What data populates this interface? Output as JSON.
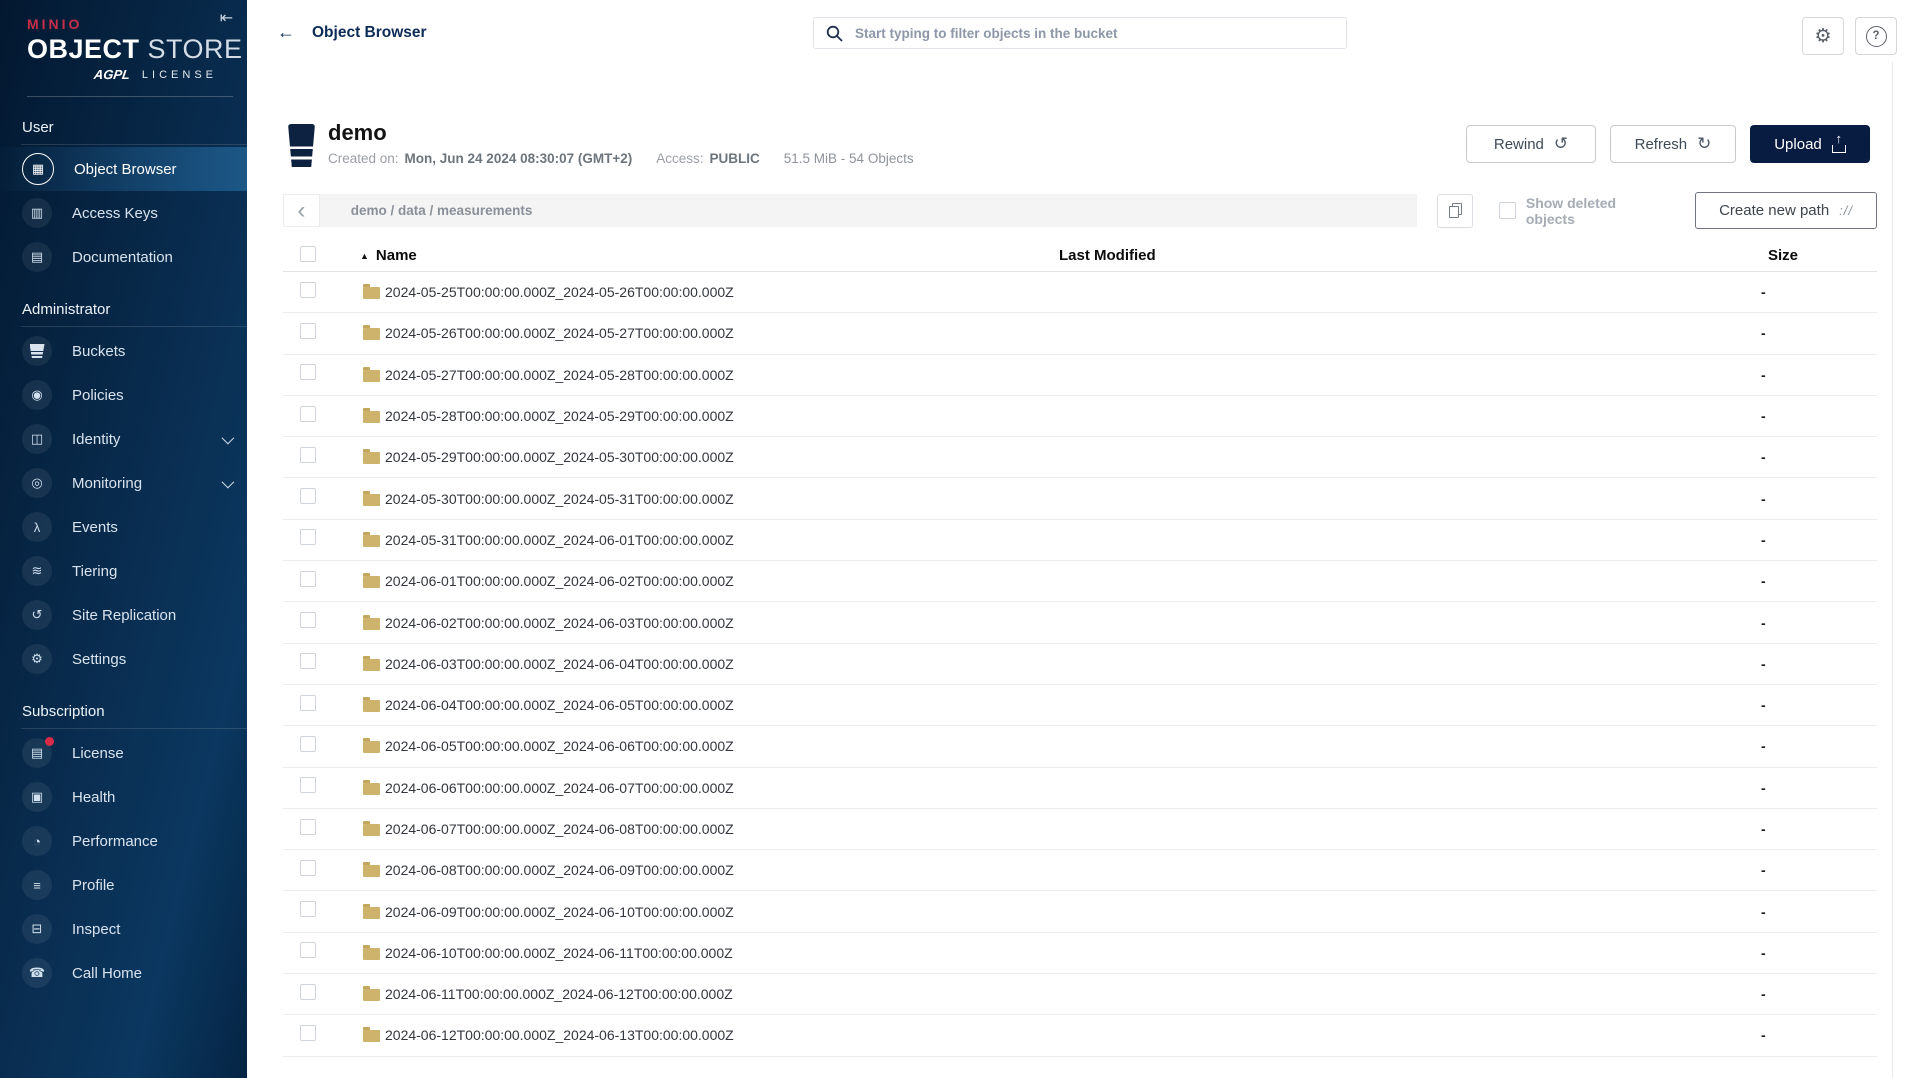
{
  "colors": {
    "accent_navy": "#081C42",
    "minio_red": "#C72E49",
    "sidebar_highlight": "#1C5786",
    "folder_gold": "#CDB36C"
  },
  "sidebar": {
    "collapse_glyph": "⇤",
    "logo": {
      "brand": "MINIO",
      "product_bold": "OBJECT",
      "product_light": "STORE",
      "license_badge": "AGPL",
      "license_word": "LICENSE"
    },
    "sections": [
      {
        "label": "User",
        "items": [
          {
            "id": "object-browser",
            "label": "Object Browser",
            "icon": "object-browser-icon",
            "glyph": "▦",
            "active": true
          },
          {
            "id": "access-keys",
            "label": "Access Keys",
            "icon": "access-keys-icon",
            "glyph": "▥"
          },
          {
            "id": "documentation",
            "label": "Documentation",
            "icon": "documentation-icon",
            "glyph": "▤"
          }
        ]
      },
      {
        "label": "Administrator",
        "items": [
          {
            "id": "buckets",
            "label": "Buckets",
            "icon": "bucket-icon",
            "glyph": ""
          },
          {
            "id": "policies",
            "label": "Policies",
            "icon": "policies-icon",
            "glyph": "◉"
          },
          {
            "id": "identity",
            "label": "Identity",
            "icon": "identity-icon",
            "glyph": "◫",
            "chevron": true
          },
          {
            "id": "monitoring",
            "label": "Monitoring",
            "icon": "monitoring-icon",
            "glyph": "◎",
            "chevron": true
          },
          {
            "id": "events",
            "label": "Events",
            "icon": "events-lambda-icon",
            "glyph": "λ"
          },
          {
            "id": "tiering",
            "label": "Tiering",
            "icon": "tiering-layers-icon",
            "glyph": "≋"
          },
          {
            "id": "site-replication",
            "label": "Site Replication",
            "icon": "site-replication-icon",
            "glyph": "↺"
          },
          {
            "id": "settings",
            "label": "Settings",
            "icon": "settings-gear-icon",
            "glyph": "⚙"
          }
        ]
      },
      {
        "label": "Subscription",
        "items": [
          {
            "id": "license",
            "label": "License",
            "icon": "license-icon",
            "glyph": "▤",
            "badge": true
          },
          {
            "id": "health",
            "label": "Health",
            "icon": "health-icon",
            "glyph": "▣"
          },
          {
            "id": "performance",
            "label": "Performance",
            "icon": "performance-gauge-icon",
            "glyph": "◔"
          },
          {
            "id": "profile",
            "label": "Profile",
            "icon": "profile-icon",
            "glyph": "≡"
          },
          {
            "id": "inspect",
            "label": "Inspect",
            "icon": "inspect-icon",
            "glyph": "⊟"
          },
          {
            "id": "call-home",
            "label": "Call Home",
            "icon": "call-home-phone-icon",
            "glyph": "☎"
          }
        ]
      }
    ]
  },
  "header": {
    "back_glyph": "←",
    "title": "Object Browser",
    "search_placeholder": "Start typing to filter objects in the bucket",
    "gear_glyph": "⚙",
    "help_glyph": "?"
  },
  "bucket": {
    "name": "demo",
    "created_label": "Created on:",
    "created_value": "Mon, Jun 24 2024 08:30:07 (GMT+2)",
    "access_label": "Access:",
    "access_value": "PUBLIC",
    "usage": "51.5 MiB - 54 Objects",
    "actions": {
      "rewind_label": "Rewind",
      "rewind_glyph": "↺",
      "refresh_label": "Refresh",
      "refresh_glyph": "↻",
      "upload_label": "Upload"
    }
  },
  "browser": {
    "back_glyph": "‹",
    "path": "demo / data / measurements",
    "show_deleted_label": "Show deleted objects",
    "show_deleted_checked": false,
    "create_path_label": "Create new path",
    "create_path_glyph": "://"
  },
  "table": {
    "sort_glyph": "▲",
    "columns": [
      "Name",
      "Last Modified",
      "Size"
    ],
    "rows": [
      {
        "name": "2024-05-25T00:00:00.000Z_2024-05-26T00:00:00.000Z",
        "last_modified": "",
        "size": "-"
      },
      {
        "name": "2024-05-26T00:00:00.000Z_2024-05-27T00:00:00.000Z",
        "last_modified": "",
        "size": "-"
      },
      {
        "name": "2024-05-27T00:00:00.000Z_2024-05-28T00:00:00.000Z",
        "last_modified": "",
        "size": "-"
      },
      {
        "name": "2024-05-28T00:00:00.000Z_2024-05-29T00:00:00.000Z",
        "last_modified": "",
        "size": "-"
      },
      {
        "name": "2024-05-29T00:00:00.000Z_2024-05-30T00:00:00.000Z",
        "last_modified": "",
        "size": "-"
      },
      {
        "name": "2024-05-30T00:00:00.000Z_2024-05-31T00:00:00.000Z",
        "last_modified": "",
        "size": "-"
      },
      {
        "name": "2024-05-31T00:00:00.000Z_2024-06-01T00:00:00.000Z",
        "last_modified": "",
        "size": "-"
      },
      {
        "name": "2024-06-01T00:00:00.000Z_2024-06-02T00:00:00.000Z",
        "last_modified": "",
        "size": "-"
      },
      {
        "name": "2024-06-02T00:00:00.000Z_2024-06-03T00:00:00.000Z",
        "last_modified": "",
        "size": "-"
      },
      {
        "name": "2024-06-03T00:00:00.000Z_2024-06-04T00:00:00.000Z",
        "last_modified": "",
        "size": "-"
      },
      {
        "name": "2024-06-04T00:00:00.000Z_2024-06-05T00:00:00.000Z",
        "last_modified": "",
        "size": "-"
      },
      {
        "name": "2024-06-05T00:00:00.000Z_2024-06-06T00:00:00.000Z",
        "last_modified": "",
        "size": "-"
      },
      {
        "name": "2024-06-06T00:00:00.000Z_2024-06-07T00:00:00.000Z",
        "last_modified": "",
        "size": "-"
      },
      {
        "name": "2024-06-07T00:00:00.000Z_2024-06-08T00:00:00.000Z",
        "last_modified": "",
        "size": "-"
      },
      {
        "name": "2024-06-08T00:00:00.000Z_2024-06-09T00:00:00.000Z",
        "last_modified": "",
        "size": "-"
      },
      {
        "name": "2024-06-09T00:00:00.000Z_2024-06-10T00:00:00.000Z",
        "last_modified": "",
        "size": "-"
      },
      {
        "name": "2024-06-10T00:00:00.000Z_2024-06-11T00:00:00.000Z",
        "last_modified": "",
        "size": "-"
      },
      {
        "name": "2024-06-11T00:00:00.000Z_2024-06-12T00:00:00.000Z",
        "last_modified": "",
        "size": "-"
      },
      {
        "name": "2024-06-12T00:00:00.000Z_2024-06-13T00:00:00.000Z",
        "last_modified": "",
        "size": "-"
      }
    ]
  }
}
